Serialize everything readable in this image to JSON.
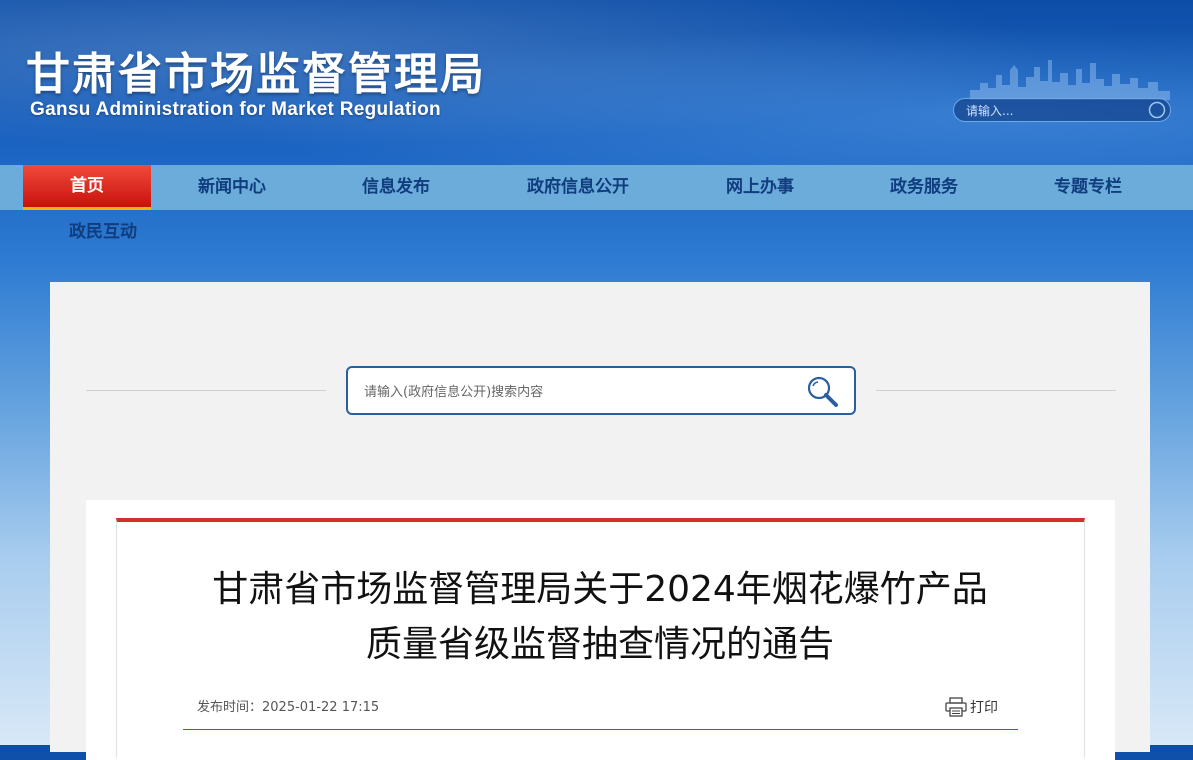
{
  "header": {
    "title_cn": "甘肃省市场监督管理局",
    "title_en": "Gansu Administration for Market Regulation",
    "search_placeholder": "请输入..."
  },
  "nav": {
    "items": [
      {
        "label": "首页",
        "active": true
      },
      {
        "label": "新闻中心"
      },
      {
        "label": "信息发布"
      },
      {
        "label": "政府信息公开"
      },
      {
        "label": "网上办事"
      },
      {
        "label": "政务服务"
      },
      {
        "label": "专题专栏"
      },
      {
        "label": "政民互动"
      }
    ]
  },
  "search": {
    "placeholder": "请输入(政府信息公开)搜索内容"
  },
  "article": {
    "title_line1": "甘肃省市场监督管理局关于2024年烟花爆竹产品",
    "title_line2": "质量省级监督抽查情况的通告",
    "publish_label": "发布时间：",
    "publish_time": "2025-01-22 17:15",
    "print_label": "打印"
  },
  "colors": {
    "nav_bg": "#6cacdb",
    "active_red": "#d3302c",
    "nav_text": "#103d7e"
  }
}
